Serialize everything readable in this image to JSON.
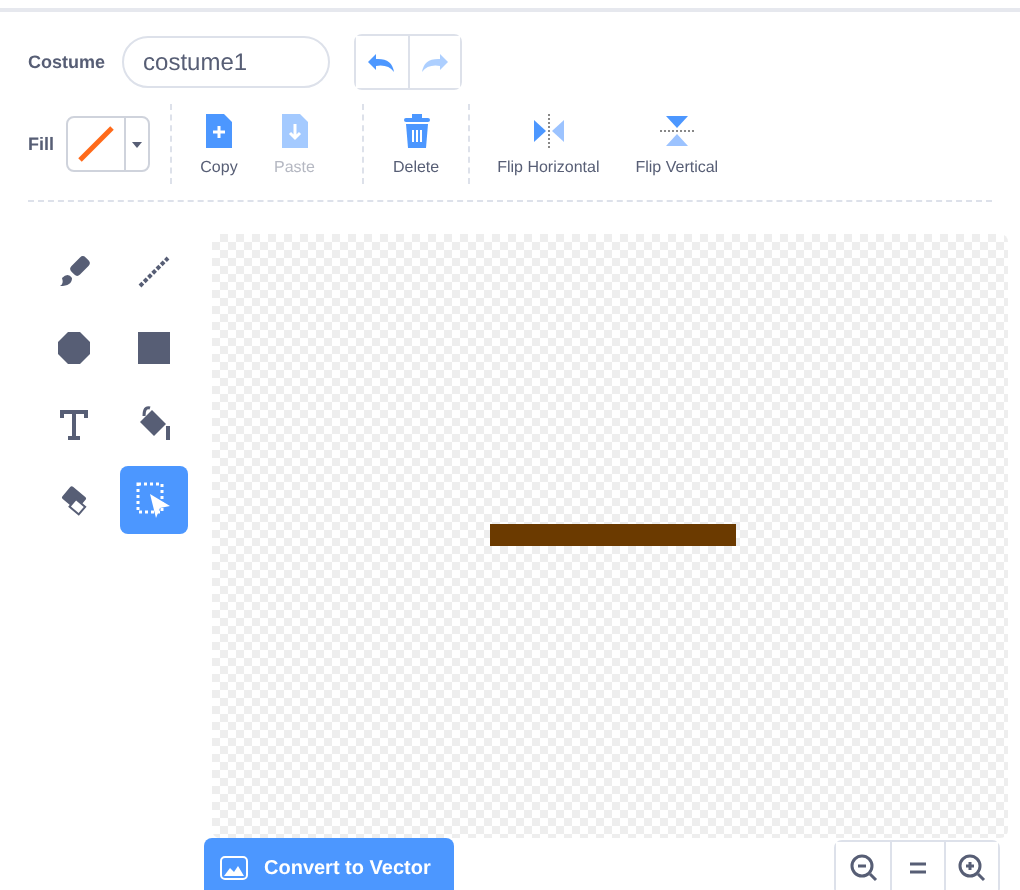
{
  "costume": {
    "label": "Costume",
    "value": "costume1"
  },
  "history": [
    {
      "kind": "undo",
      "disabled": false
    },
    {
      "kind": "redo",
      "disabled": true
    }
  ],
  "fill": {
    "label": "Fill"
  },
  "actions": [
    {
      "kind": "copy",
      "label": "Copy",
      "disabled": false
    },
    {
      "kind": "paste",
      "label": "Paste",
      "disabled": true
    },
    {
      "kind": "delete",
      "label": "Delete",
      "disabled": false
    },
    {
      "kind": "flip-h",
      "label": "Flip Horizontal",
      "disabled": false
    },
    {
      "kind": "flip-v",
      "label": "Flip Vertical",
      "disabled": false
    }
  ],
  "tools": [
    {
      "kind": "brush",
      "selected": false
    },
    {
      "kind": "line",
      "selected": false
    },
    {
      "kind": "circle",
      "selected": false
    },
    {
      "kind": "rectangle",
      "selected": false
    },
    {
      "kind": "text",
      "selected": false
    },
    {
      "kind": "fill",
      "selected": false
    },
    {
      "kind": "eraser",
      "selected": false
    },
    {
      "kind": "select",
      "selected": true
    }
  ],
  "convert_button": {
    "label": "Convert to Vector"
  },
  "zoom": [
    {
      "kind": "zoom-out"
    },
    {
      "kind": "reset"
    },
    {
      "kind": "zoom-in"
    }
  ]
}
